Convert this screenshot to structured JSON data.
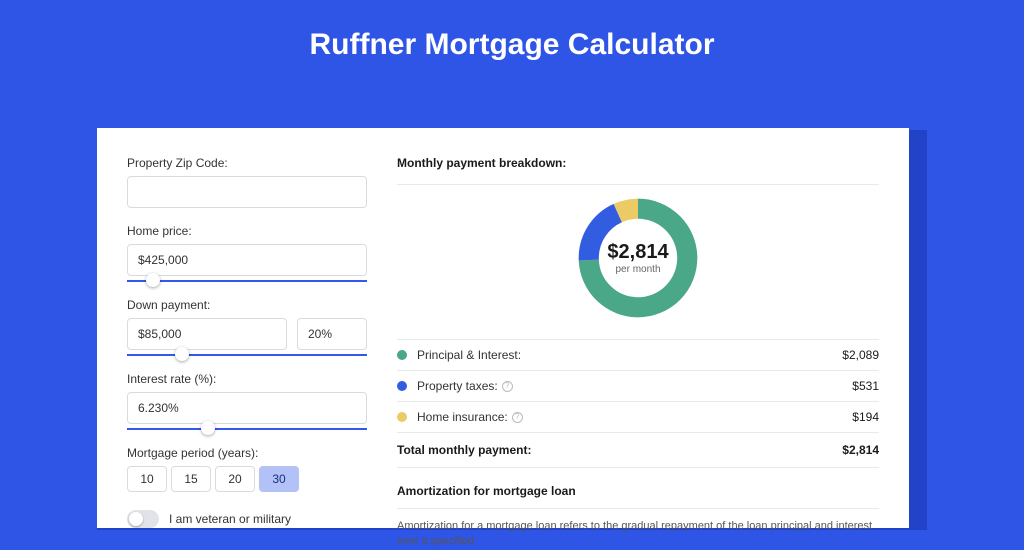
{
  "title": "Ruffner Mortgage Calculator",
  "form": {
    "zip_label": "Property Zip Code:",
    "zip_value": "",
    "home_price_label": "Home price:",
    "home_price_value": "$425,000",
    "home_price_slider_pct": 8,
    "down_label": "Down payment:",
    "down_amount": "$85,000",
    "down_pct": "20%",
    "down_slider_pct": 20,
    "rate_label": "Interest rate (%):",
    "rate_value": "6.230%",
    "rate_slider_pct": 31,
    "period_label": "Mortgage period (years):",
    "periods": [
      "10",
      "15",
      "20",
      "30"
    ],
    "period_selected": "30",
    "veteran_label": "I am veteran or military"
  },
  "breakdown": {
    "title": "Monthly payment breakdown:",
    "center_amount": "$2,814",
    "center_sub": "per month",
    "rows": [
      {
        "color": "green",
        "label": "Principal & Interest:",
        "info": false,
        "value": "$2,089"
      },
      {
        "color": "blue",
        "label": "Property taxes:",
        "info": true,
        "value": "$531"
      },
      {
        "color": "yellow",
        "label": "Home insurance:",
        "info": true,
        "value": "$194"
      }
    ],
    "total_label": "Total monthly payment:",
    "total_value": "$2,814"
  },
  "amort": {
    "title": "Amortization for mortgage loan",
    "body": "Amortization for a mortgage loan refers to the gradual repayment of the loan principal and interest over a specified"
  },
  "chart_data": {
    "type": "pie",
    "title": "Monthly payment breakdown",
    "series": [
      {
        "name": "Principal & Interest",
        "value": 2089,
        "color": "#4aa889"
      },
      {
        "name": "Property taxes",
        "value": 531,
        "color": "#335de0"
      },
      {
        "name": "Home insurance",
        "value": 194,
        "color": "#ecca66"
      }
    ],
    "total": 2814,
    "center_label": "$2,814 per month"
  }
}
